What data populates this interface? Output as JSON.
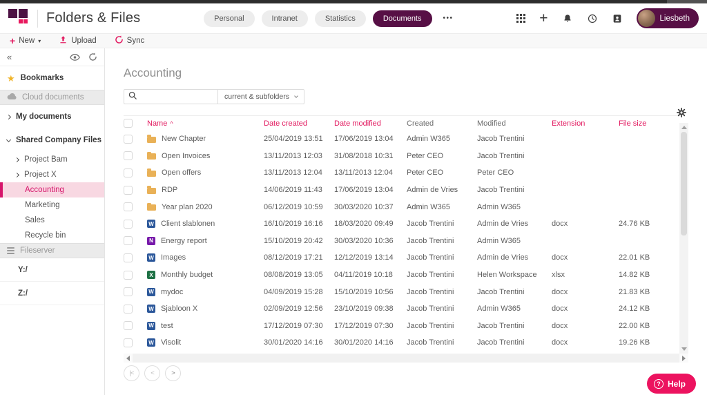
{
  "header": {
    "app_title": "Folders & Files",
    "nav_pills": [
      {
        "label": "Personal",
        "active": false
      },
      {
        "label": "Intranet",
        "active": false
      },
      {
        "label": "Statistics",
        "active": false
      },
      {
        "label": "Documents",
        "active": true
      }
    ],
    "more_menu_label": "•••",
    "icons": [
      "app-launcher",
      "add",
      "notifications",
      "recent",
      "contacts"
    ],
    "user": {
      "name": "Liesbeth"
    }
  },
  "toolbar": {
    "new_label": "New",
    "upload_label": "Upload",
    "sync_label": "Sync"
  },
  "sidebar": {
    "items": [
      {
        "label": "Bookmarks",
        "icon": "star",
        "variant": "top"
      },
      {
        "label": "Cloud documents",
        "icon": "cloud",
        "variant": "section",
        "disabled": true
      },
      {
        "label": "My documents",
        "icon": "chevron-right",
        "variant": "top"
      },
      {
        "label": "Shared Company Files",
        "icon": "chevron-down",
        "variant": "top"
      },
      {
        "label": "Project Bam",
        "icon": "chevron-right",
        "variant": "child"
      },
      {
        "label": "Project X",
        "icon": "chevron-right",
        "variant": "child"
      },
      {
        "label": "Accounting",
        "variant": "child-plain",
        "selected": true
      },
      {
        "label": "Marketing",
        "variant": "child-plain"
      },
      {
        "label": "Sales",
        "variant": "child-plain"
      },
      {
        "label": "Recycle bin",
        "variant": "child-plain"
      },
      {
        "label": "Fileserver",
        "icon": "server",
        "variant": "section",
        "disabled": true
      },
      {
        "label": "Y:/",
        "variant": "drive"
      },
      {
        "label": "Z:/",
        "variant": "drive"
      }
    ]
  },
  "main": {
    "title": "Accounting",
    "search": {
      "value": "",
      "scope": "current & subfolders"
    },
    "table": {
      "columns": [
        {
          "label": "Name",
          "accent": true,
          "sorted": "asc"
        },
        {
          "label": "Date created",
          "accent": true
        },
        {
          "label": "Date modified",
          "accent": true
        },
        {
          "label": "Created",
          "accent": false
        },
        {
          "label": "Modified",
          "accent": false
        },
        {
          "label": "Extension",
          "accent": true
        },
        {
          "label": "File size",
          "accent": true
        }
      ],
      "rows": [
        {
          "icon": "folder",
          "name": "New Chapter",
          "date_created": "25/04/2019 13:51",
          "date_modified": "17/06/2019 13:04",
          "created_by": "Admin W365",
          "modified_by": "Jacob Trentini",
          "extension": "",
          "file_size": ""
        },
        {
          "icon": "folder",
          "name": "Open Invoices",
          "date_created": "13/11/2013 12:03",
          "date_modified": "31/08/2018 10:31",
          "created_by": "Peter CEO",
          "modified_by": "Jacob Trentini",
          "extension": "",
          "file_size": ""
        },
        {
          "icon": "folder",
          "name": "Open offers",
          "date_created": "13/11/2013 12:04",
          "date_modified": "13/11/2013 12:04",
          "created_by": "Peter CEO",
          "modified_by": "Peter CEO",
          "extension": "",
          "file_size": ""
        },
        {
          "icon": "folder",
          "name": "RDP",
          "date_created": "14/06/2019 11:43",
          "date_modified": "17/06/2019 13:04",
          "created_by": "Admin de Vries",
          "modified_by": "Jacob Trentini",
          "extension": "",
          "file_size": ""
        },
        {
          "icon": "folder",
          "name": "Year plan 2020",
          "date_created": "06/12/2019 10:59",
          "date_modified": "30/03/2020 10:37",
          "created_by": "Admin W365",
          "modified_by": "Admin W365",
          "extension": "",
          "file_size": ""
        },
        {
          "icon": "word",
          "name": "Client slablonen",
          "date_created": "16/10/2019 16:16",
          "date_modified": "18/03/2020 09:49",
          "created_by": "Jacob Trentini",
          "modified_by": "Admin de Vries",
          "extension": "docx",
          "file_size": "24.76 KB"
        },
        {
          "icon": "onenote",
          "name": "Energy report",
          "date_created": "15/10/2019 20:42",
          "date_modified": "30/03/2020 10:36",
          "created_by": "Jacob Trentini",
          "modified_by": "Admin W365",
          "extension": "",
          "file_size": ""
        },
        {
          "icon": "word",
          "name": "Images",
          "date_created": "08/12/2019 17:21",
          "date_modified": "12/12/2019 13:14",
          "created_by": "Jacob Trentini",
          "modified_by": "Admin de Vries",
          "extension": "docx",
          "file_size": "22.01 KB"
        },
        {
          "icon": "excel",
          "name": "Monthly budget",
          "date_created": "08/08/2019 13:05",
          "date_modified": "04/11/2019 10:18",
          "created_by": "Jacob Trentini",
          "modified_by": "Helen Workspace",
          "extension": "xlsx",
          "file_size": "14.82 KB"
        },
        {
          "icon": "word",
          "name": "mydoc",
          "date_created": "04/09/2019 15:28",
          "date_modified": "15/10/2019 10:56",
          "created_by": "Jacob Trentini",
          "modified_by": "Jacob Trentini",
          "extension": "docx",
          "file_size": "21.83 KB"
        },
        {
          "icon": "word",
          "name": "Sjabloon X",
          "date_created": "02/09/2019 12:56",
          "date_modified": "23/10/2019 09:38",
          "created_by": "Jacob Trentini",
          "modified_by": "Admin W365",
          "extension": "docx",
          "file_size": "24.12 KB"
        },
        {
          "icon": "word",
          "name": "test",
          "date_created": "17/12/2019 07:30",
          "date_modified": "17/12/2019 07:30",
          "created_by": "Jacob Trentini",
          "modified_by": "Jacob Trentini",
          "extension": "docx",
          "file_size": "22.00 KB"
        },
        {
          "icon": "word",
          "name": "Visolit",
          "date_created": "30/01/2020 14:16",
          "date_modified": "30/01/2020 14:16",
          "created_by": "Jacob Trentini",
          "modified_by": "Jacob Trentini",
          "extension": "docx",
          "file_size": "19.26 KB"
        }
      ]
    },
    "pagination": [
      {
        "name": "first-page",
        "glyph": "|<"
      },
      {
        "name": "previous-page",
        "glyph": "<"
      },
      {
        "name": "next-page",
        "glyph": ">"
      }
    ],
    "help_label": "Help"
  },
  "colors": {
    "accent_pink": "#e2195f",
    "brand_maroon": "#570f45",
    "logo_dark": "#4d1243",
    "logo_pink": "#e8175d",
    "selected_item_bg": "#f8d8e2",
    "selected_item": "#d6156b",
    "help_button": "#ec135f",
    "folder_icon": "#e9b157",
    "word_icon": "#2b579a",
    "excel_icon": "#1e7145",
    "onenote_icon": "#7719aa",
    "star_icon": "#f0b429"
  }
}
